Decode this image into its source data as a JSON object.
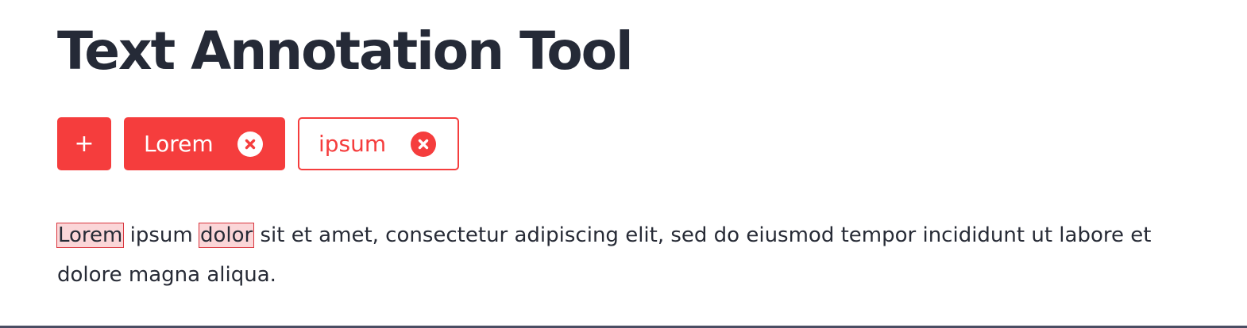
{
  "title": "Text Annotation Tool",
  "toolbar": {
    "add_label": "+",
    "tags": [
      {
        "label": "Lorem",
        "selected": true
      },
      {
        "label": "ipsum",
        "selected": false
      }
    ]
  },
  "content": {
    "segments": [
      {
        "text": "Lorem",
        "annotated": true
      },
      {
        "text": " ipsum ",
        "annotated": false
      },
      {
        "text": "dolor",
        "annotated": true
      },
      {
        "text": " sit et amet, consectetur adipiscing elit, sed do eiusmod tempor incididunt ut labore et dolore magna aliqua.",
        "annotated": false
      }
    ]
  },
  "icons": {
    "add": "plus-icon",
    "remove": "close-circle-icon"
  },
  "colors": {
    "accent": "#f53d3d",
    "highlight_fill": "#fbd6d8",
    "highlight_border": "#d9363e",
    "text": "#272b36",
    "rule": "#4a4d63"
  }
}
